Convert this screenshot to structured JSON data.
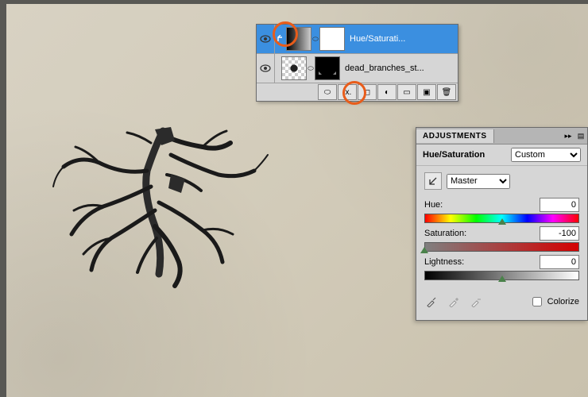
{
  "layers": {
    "row1": {
      "name": "Hue/Saturati..."
    },
    "row2": {
      "name": "dead_branches_st..."
    },
    "footerIcons": {
      "link": "⬭",
      "fx": "fx.",
      "mask": "◻",
      "adj": "◐",
      "group": "▭",
      "new": "▣",
      "trash": "🗑"
    }
  },
  "adjustments": {
    "tabLabel": "ADJUSTMENTS",
    "title": "Hue/Saturation",
    "preset": "Custom",
    "channel": "Master",
    "hue": {
      "label": "Hue:",
      "value": "0"
    },
    "saturation": {
      "label": "Saturation:",
      "value": "-100"
    },
    "lightness": {
      "label": "Lightness:",
      "value": "0"
    },
    "colorize": "Colorize"
  }
}
